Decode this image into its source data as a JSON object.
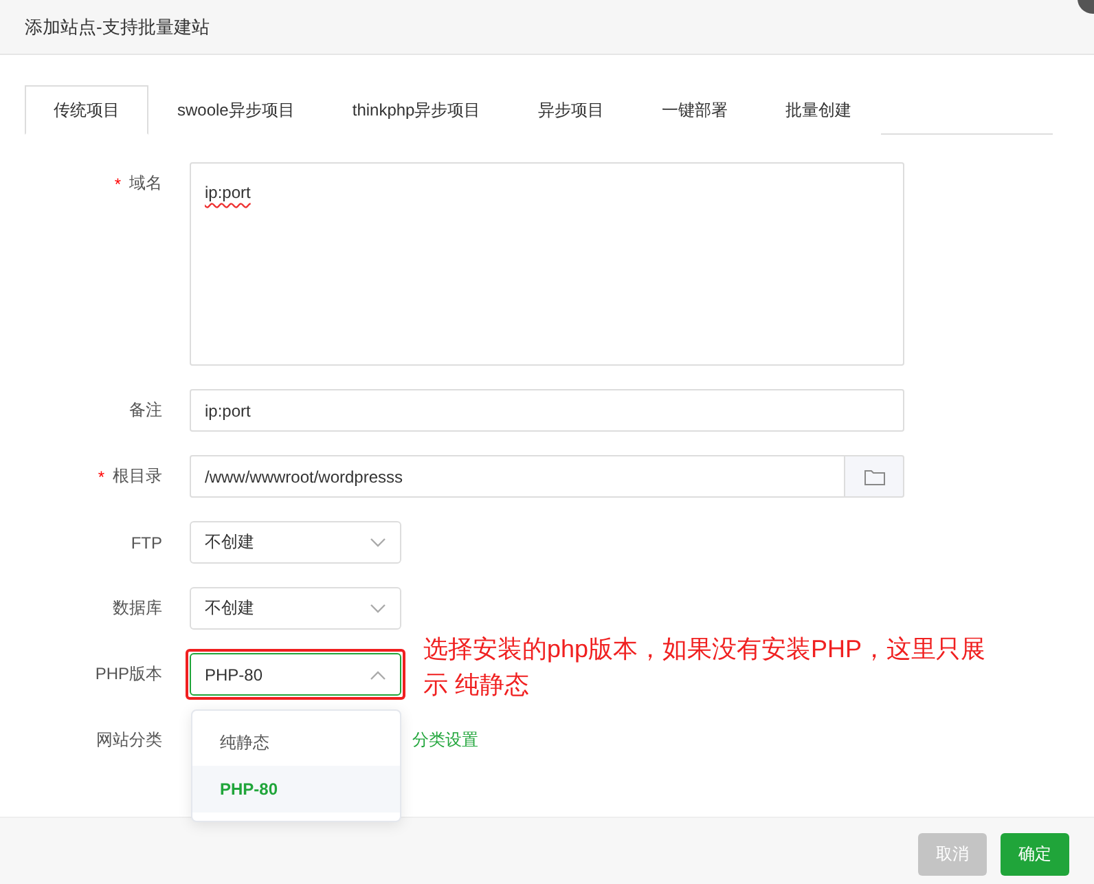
{
  "dialog": {
    "title": "添加站点-支持批量建站"
  },
  "tabs": [
    {
      "label": "传统项目",
      "selected": true
    },
    {
      "label": "swoole异步项目",
      "selected": false
    },
    {
      "label": "thinkphp异步项目",
      "selected": false
    },
    {
      "label": "异步项目",
      "selected": false
    },
    {
      "label": "一键部署",
      "selected": false
    },
    {
      "label": "批量创建",
      "selected": false
    }
  ],
  "fields": [
    {
      "kind": "textarea",
      "label": "域名",
      "required_mark": "*",
      "value": "ip:port"
    },
    {
      "kind": "input",
      "label": "备注",
      "value": "ip:port"
    },
    {
      "kind": "path",
      "label": "根目录",
      "required_mark": "*",
      "value": "/www/wwwroot/wordpresss"
    },
    {
      "kind": "select",
      "label": "FTP",
      "value": "不创建"
    },
    {
      "kind": "select",
      "label": "数据库",
      "value": "不创建"
    },
    {
      "kind": "open-select",
      "label": "PHP版本",
      "value": "PHP-80",
      "annotation": "选择安装的php版本，如果没有安装PHP，这里只展示 纯静态",
      "options": [
        {
          "label": "纯静态",
          "selected": false
        },
        {
          "label": "PHP-80",
          "selected": true
        }
      ]
    },
    {
      "kind": "hidden-select",
      "label": "网站分类",
      "link": "分类设置"
    }
  ],
  "buttons": [
    {
      "label": "取消",
      "kind": "secondary"
    },
    {
      "label": "确定",
      "kind": "primary"
    }
  ]
}
